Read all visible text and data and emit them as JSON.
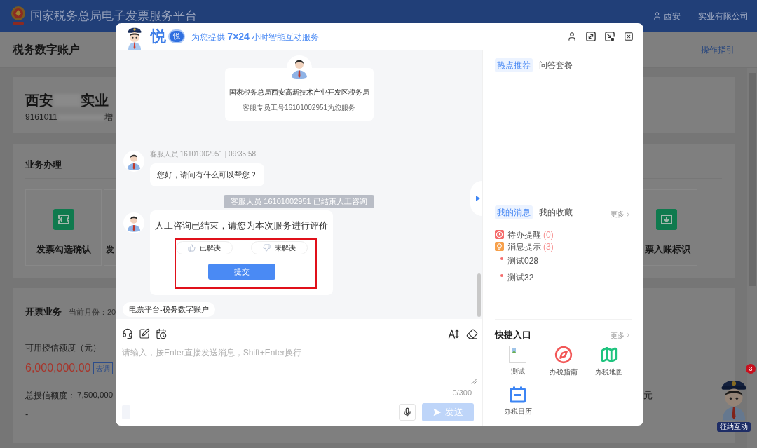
{
  "background_page": {
    "header": {
      "title": "国家税务总局电子发票服务平台",
      "user_name_start": "西安",
      "user_name_end": "实业有限公司"
    },
    "subheader": {
      "title": "税务数字账户",
      "guide_link": "操作指引"
    },
    "company_card": {
      "name_start": "西安",
      "name_end": "实业",
      "tax_id": "9161011",
      "tax_type": "增"
    },
    "business_card": {
      "title": "业务办理",
      "tiles": [
        {
          "label": "发票勾选确认"
        },
        {
          "label": "发"
        },
        {
          "label": "票入账标识"
        }
      ]
    },
    "invoicing_card": {
      "title": "开票业务",
      "current_month": "当前月份：20",
      "available_label": "可用授信额度（元）",
      "available_amount": "6,000,000.00",
      "adjust_button": "去调",
      "total_label": "总授信额度：",
      "total_amount": "7,500,000",
      "dash": "-",
      "unit": "元"
    },
    "assistant": {
      "caption": "征纳互动",
      "badge": "3"
    }
  },
  "chat_window": {
    "header": {
      "brand": "悦",
      "brand_badge": "悦",
      "tagline": "为您提供 **7×24** 小时智能互动服务"
    },
    "agent_card": {
      "office": "国家税务总局西安高新技术产业开发区税务局",
      "service_line": "客服专员工号16101002951为您服务"
    },
    "messages": [
      {
        "kind": "text",
        "meta": "客服人员 16101002951 | 09:35:58",
        "text": "您好，请问有什么可以帮您？"
      },
      {
        "kind": "notice",
        "text": "客服人员 16101002951 已结束人工咨询"
      },
      {
        "kind": "rating",
        "text": "人工咨询已结束，请您为本次服务进行评价",
        "highlighted": true,
        "options": [
          {
            "label": "已解决",
            "selected": false
          },
          {
            "label": "未解决",
            "selected": false
          }
        ],
        "submit_button": "提交"
      }
    ],
    "quick_chip": "电票平台-税务数字账户",
    "input": {
      "placeholder": "请输入，按Enter直接发送消息，Shift+Enter换行",
      "counter": "0/300",
      "send_button": {
        "label": "发送",
        "disabled": true
      }
    },
    "side_panel": {
      "hot_tabs": [
        {
          "label": "热点推荐",
          "selected": true
        },
        {
          "label": "问答套餐",
          "selected": false
        }
      ],
      "message_tabs": [
        {
          "label": "我的消息",
          "selected": true
        },
        {
          "label": "我的收藏",
          "selected": false
        }
      ],
      "messages_more": "更多",
      "notices": [
        {
          "label": "待办提醒",
          "count": "(0)"
        },
        {
          "label": "消息提示",
          "count": "(3)"
        }
      ],
      "notice_items": [
        "测试028",
        "测试32"
      ],
      "shortcuts_title": "快捷入口",
      "shortcuts_more": "更多",
      "shortcuts": [
        {
          "label": "测试"
        },
        {
          "label": "办税指南"
        },
        {
          "label": "办税地图"
        },
        {
          "label": "办税日历"
        }
      ]
    }
  }
}
